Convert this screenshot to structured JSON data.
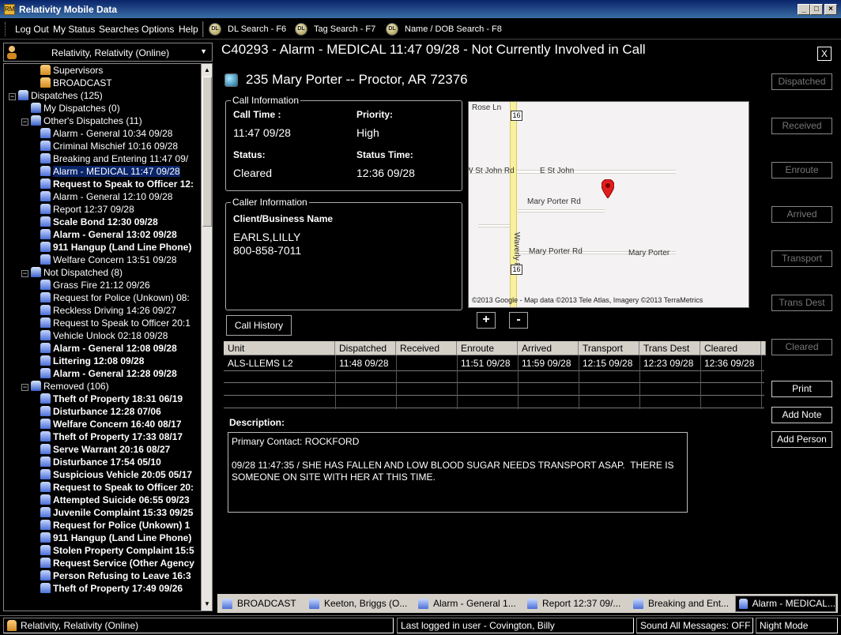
{
  "window": {
    "title": "Relativity Mobile Data"
  },
  "menu": {
    "items": [
      "Log Out",
      "My Status",
      "Searches",
      "Options",
      "Help"
    ],
    "tools": [
      "DL Search - F6",
      "Tag Search - F7",
      "Name / DOB Search - F8"
    ]
  },
  "left": {
    "unit_label": "Relativity, Relativity (Online)",
    "tree": [
      {
        "text": "Supervisors",
        "level": 2,
        "bold": false,
        "icon": "sup"
      },
      {
        "text": "BROADCAST",
        "level": 2,
        "bold": false,
        "icon": "sup"
      },
      {
        "text": "Dispatches (125)",
        "level": 0,
        "bold": false,
        "icon": "group",
        "expander": "−"
      },
      {
        "text": "My Dispatches (0)",
        "level": 1,
        "bold": false,
        "icon": "group"
      },
      {
        "text": "Other's Dispatches (11)",
        "level": 1,
        "bold": false,
        "icon": "group",
        "expander": "−"
      },
      {
        "text": "Alarm - General 10:34 09/28",
        "level": 2,
        "bold": false,
        "icon": "unit"
      },
      {
        "text": "Criminal Mischief 10:16 09/28",
        "level": 2,
        "bold": false,
        "icon": "unit"
      },
      {
        "text": "Breaking and Entering 11:47 09/",
        "level": 2,
        "bold": false,
        "icon": "unit"
      },
      {
        "text": "Alarm - MEDICAL 11:47 09/28",
        "level": 2,
        "bold": false,
        "icon": "unit",
        "selected": true
      },
      {
        "text": "Request to Speak to Officer 12:",
        "level": 2,
        "bold": true,
        "icon": "unit"
      },
      {
        "text": "Alarm - General 12:10 09/28",
        "level": 2,
        "bold": false,
        "icon": "unit"
      },
      {
        "text": "Report 12:37 09/28",
        "level": 2,
        "bold": false,
        "icon": "unit"
      },
      {
        "text": "Scale Bond 12:30 09/28",
        "level": 2,
        "bold": true,
        "icon": "unit"
      },
      {
        "text": "Alarm - General 13:02 09/28",
        "level": 2,
        "bold": true,
        "icon": "unit"
      },
      {
        "text": "911 Hangup (Land Line Phone)",
        "level": 2,
        "bold": true,
        "icon": "unit"
      },
      {
        "text": "Welfare Concern 13:51 09/28",
        "level": 2,
        "bold": false,
        "icon": "unit"
      },
      {
        "text": "Not Dispatched (8)",
        "level": 1,
        "bold": false,
        "icon": "group",
        "expander": "−"
      },
      {
        "text": "Grass Fire 21:12 09/26",
        "level": 2,
        "bold": false,
        "icon": "unit"
      },
      {
        "text": "Request for Police (Unkown) 08:",
        "level": 2,
        "bold": false,
        "icon": "unit"
      },
      {
        "text": "Reckless Driving 14:26 09/27",
        "level": 2,
        "bold": false,
        "icon": "unit"
      },
      {
        "text": "Request to Speak to Officer 20:1",
        "level": 2,
        "bold": false,
        "icon": "unit"
      },
      {
        "text": "Vehicle Unlock 02:18 09/28",
        "level": 2,
        "bold": false,
        "icon": "unit"
      },
      {
        "text": "Alarm - General 12:08 09/28",
        "level": 2,
        "bold": true,
        "icon": "unit"
      },
      {
        "text": "Littering 12:08 09/28",
        "level": 2,
        "bold": true,
        "icon": "unit"
      },
      {
        "text": "Alarm - General 12:28 09/28",
        "level": 2,
        "bold": true,
        "icon": "unit"
      },
      {
        "text": "Removed (106)",
        "level": 1,
        "bold": false,
        "icon": "group",
        "expander": "−"
      },
      {
        "text": "Theft of Property 18:31 06/19",
        "level": 2,
        "bold": true,
        "icon": "unit"
      },
      {
        "text": "Disturbance 12:28 07/06",
        "level": 2,
        "bold": true,
        "icon": "unit"
      },
      {
        "text": "Welfare Concern 16:40 08/17",
        "level": 2,
        "bold": true,
        "icon": "unit"
      },
      {
        "text": "Theft of Property 17:33 08/17",
        "level": 2,
        "bold": true,
        "icon": "unit"
      },
      {
        "text": "Serve Warrant 20:16 08/27",
        "level": 2,
        "bold": true,
        "icon": "unit"
      },
      {
        "text": "Disturbance 17:54 05/10",
        "level": 2,
        "bold": true,
        "icon": "unit"
      },
      {
        "text": "Suspicious Vehicle 20:05 05/17",
        "level": 2,
        "bold": true,
        "icon": "unit"
      },
      {
        "text": "Request to Speak to Officer 20:",
        "level": 2,
        "bold": true,
        "icon": "unit"
      },
      {
        "text": "Attempted Suicide 06:55 09/23",
        "level": 2,
        "bold": true,
        "icon": "unit"
      },
      {
        "text": "Juvenile Complaint 15:33 09/25",
        "level": 2,
        "bold": true,
        "icon": "unit"
      },
      {
        "text": "Request for Police (Unkown) 1",
        "level": 2,
        "bold": true,
        "icon": "unit"
      },
      {
        "text": "911 Hangup (Land Line Phone)",
        "level": 2,
        "bold": true,
        "icon": "unit"
      },
      {
        "text": "Stolen Property Complaint 15:5",
        "level": 2,
        "bold": true,
        "icon": "unit"
      },
      {
        "text": "Request Service (Other Agency",
        "level": 2,
        "bold": true,
        "icon": "unit"
      },
      {
        "text": "Person Refusing to Leave 16:3",
        "level": 2,
        "bold": true,
        "icon": "unit"
      },
      {
        "text": "Theft of Property 17:49 09/26",
        "level": 2,
        "bold": true,
        "icon": "unit"
      }
    ]
  },
  "call": {
    "header": "C40293 - Alarm - MEDICAL 11:47 09/28 - Not Currently Involved in Call",
    "close": "X",
    "address": "235 Mary Porter  -- Proctor, AR 72376",
    "info_legend": "Call Information",
    "call_time_label": "Call Time :",
    "call_time": "11:47 09/28",
    "priority_label": "Priority:",
    "priority": "High",
    "status_label": "Status:",
    "status": "Cleared",
    "status_time_label": "Status Time:",
    "status_time": "12:36 09/28",
    "caller_legend": "Caller Information",
    "client_label": "Client/Business Name",
    "client_name": "EARLS,LILLY",
    "client_phone": "800-858-7011",
    "history_button": "Call History",
    "description_label": "Description:",
    "description": "Primary Contact: ROCKFORD\n\n09/28 11:47:35 / SHE HAS FALLEN AND LOW BLOOD SUGAR NEEDS TRANSPORT ASAP.  THERE IS SOMEONE ON SITE WITH HER AT THIS TIME."
  },
  "map": {
    "labels": {
      "rose": "Rose Ln",
      "stjohn_w": "W St John Rd",
      "stjohn_e": "E St John",
      "mp_rd1": "Mary Porter Rd",
      "waverly": "Waverly Rd",
      "mp_rd2": "Mary Porter Rd",
      "mp": "Mary Porter",
      "hw1": "16",
      "hw2": "16"
    },
    "attribution": "©2013 Google - Map data ©2013 Tele Atlas, Imagery ©2013 TerraMetrics",
    "zoom_in": "+",
    "zoom_out": "-"
  },
  "status_buttons": [
    {
      "label": "Dispatched",
      "active": false
    },
    {
      "label": "Received",
      "active": false
    },
    {
      "label": "Enroute",
      "active": false
    },
    {
      "label": "Arrived",
      "active": false
    },
    {
      "label": "Transport",
      "active": false
    },
    {
      "label": "Trans Dest",
      "active": false
    },
    {
      "label": "Cleared",
      "active": false
    },
    {
      "label": "Print",
      "active": true
    },
    {
      "label": "Add Note",
      "active": true
    },
    {
      "label": "Add Person",
      "active": true
    }
  ],
  "units_table": {
    "columns": [
      "Unit",
      "Dispatched",
      "Received",
      "Enroute",
      "Arrived",
      "Transport",
      "Trans Dest",
      "Cleared"
    ],
    "rows": [
      [
        "ALS-LLEMS L2",
        "11:48 09/28",
        "",
        "11:51 09/28",
        "11:59 09/28",
        "12:15 09/28",
        "12:23 09/28",
        "12:36 09/28"
      ]
    ]
  },
  "tabs": [
    "BROADCAST",
    "Keeton, Briggs (O...",
    "Alarm - General 1...",
    "Report 12:37 09/...",
    "Breaking and Ent...",
    "Alarm - MEDICAL..."
  ],
  "statusbar": {
    "unit": "Relativity, Relativity (Online)",
    "last_login": "Last logged in user - Covington, Billy",
    "sound": "Sound All Messages: OFF",
    "mode": "Night Mode"
  }
}
